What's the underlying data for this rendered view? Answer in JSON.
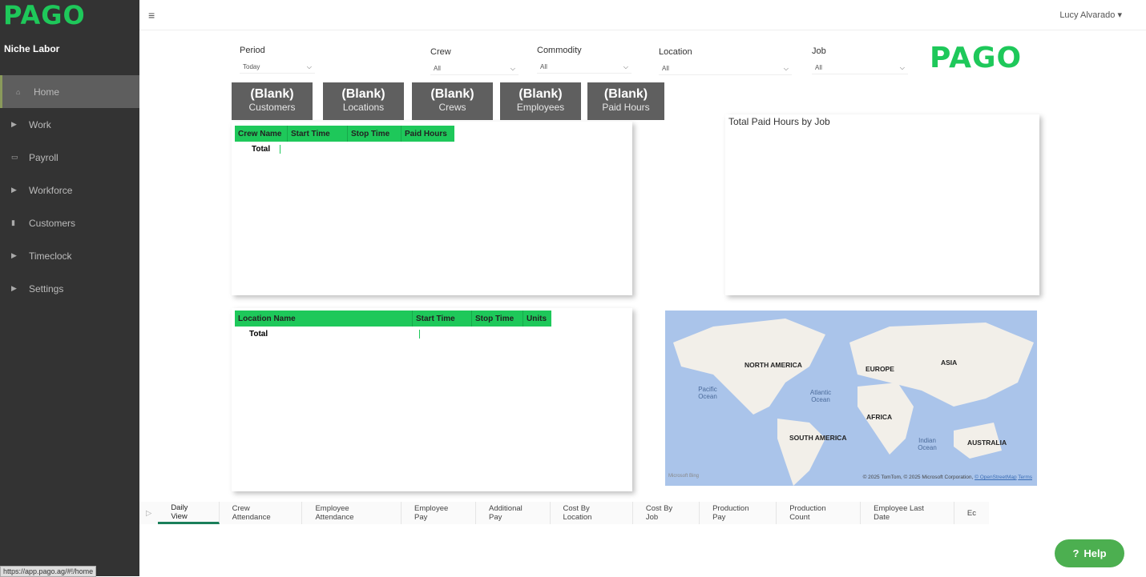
{
  "sidebar": {
    "logo": "PAGO",
    "org": "Niche Labor",
    "items": [
      {
        "label": "Home",
        "icon": "home-icon"
      },
      {
        "label": "Work",
        "icon": "caret-right-icon"
      },
      {
        "label": "Payroll",
        "icon": "money-icon"
      },
      {
        "label": "Workforce",
        "icon": "caret-right-icon"
      },
      {
        "label": "Customers",
        "icon": "building-icon"
      },
      {
        "label": "Timeclock",
        "icon": "caret-right-icon"
      },
      {
        "label": "Settings",
        "icon": "caret-right-icon"
      }
    ]
  },
  "topbar": {
    "user": "Lucy Alvarado ▾"
  },
  "filters": {
    "period": {
      "label": "Period",
      "value": "Today"
    },
    "crew": {
      "label": "Crew",
      "value": "All"
    },
    "commodity": {
      "label": "Commodity",
      "value": "All"
    },
    "location": {
      "label": "Location",
      "value": "All"
    },
    "job": {
      "label": "Job",
      "value": "All"
    }
  },
  "brand_logo": "PAGO",
  "cards": [
    {
      "value": "(Blank)",
      "label": "Customers"
    },
    {
      "value": "(Blank)",
      "label": "Locations"
    },
    {
      "value": "(Blank)",
      "label": "Crews"
    },
    {
      "value": "(Blank)",
      "label": "Employees"
    },
    {
      "value": "(Blank)",
      "label": "Paid Hours"
    }
  ],
  "crew_table": {
    "columns": [
      "Crew Name",
      "Start Time",
      "Stop Time",
      "Paid Hours"
    ],
    "total": "Total"
  },
  "location_table": {
    "columns": [
      "Location Name",
      "Start Time",
      "Stop Time",
      "Units"
    ],
    "total": "Total"
  },
  "chart": {
    "title": "Total Paid Hours by Job"
  },
  "map": {
    "labels": [
      "NORTH AMERICA",
      "EUROPE",
      "ASIA",
      "AFRICA",
      "SOUTH AMERICA",
      "AUSTRALIA"
    ],
    "oceans": [
      "Pacific Ocean",
      "Atlantic Ocean",
      "Indian Ocean"
    ],
    "attribution": "© 2025 TomTom, © 2025 Microsoft Corporation,",
    "osm": "© OpenStreetMap",
    "terms": "Terms",
    "bing": "Microsoft Bing"
  },
  "tabs": [
    "Daily View",
    "Crew Attendance",
    "Employee Attendance",
    "Employee Pay",
    "Additional Pay",
    "Cost By Location",
    "Cost By Job",
    "Production Pay",
    "Production Count",
    "Employee Last Date",
    "Ec"
  ],
  "help": "Help",
  "status_url": "https://app.pago.ag/#!/home",
  "colors": {
    "brand": "#1ec85a",
    "sidebar": "#333333"
  }
}
